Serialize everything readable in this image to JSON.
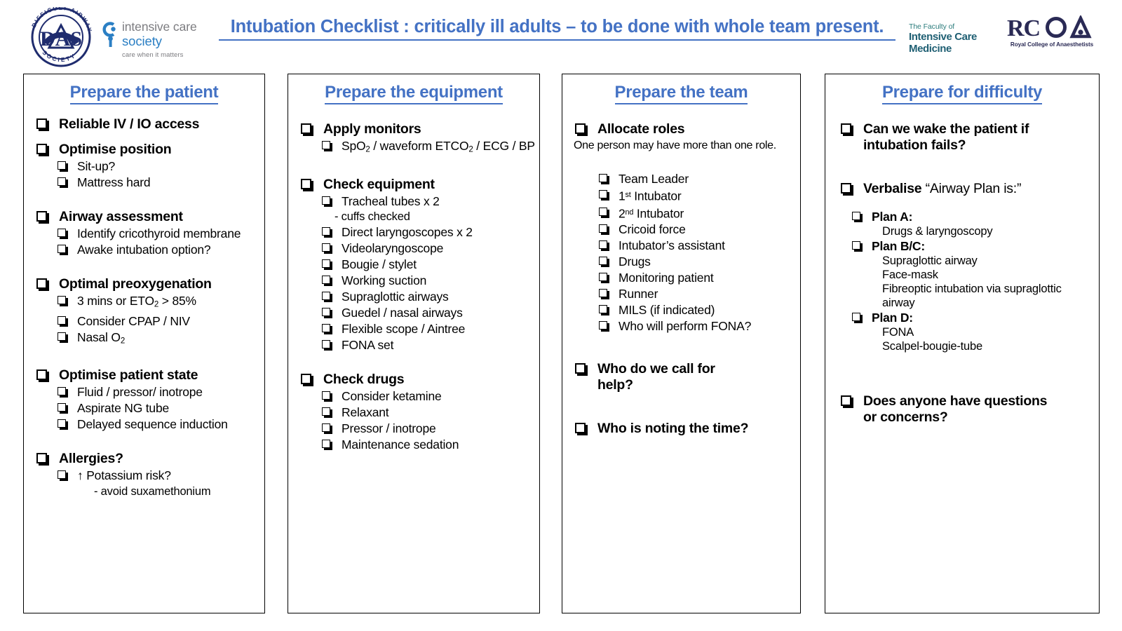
{
  "header": {
    "title": "Intubation Checklist : critically ill adults – to be done with whole team present.",
    "das_logo": {
      "name": "das-logo",
      "initials": "DAS",
      "ring_top": "DIFFICULT AIRWAY",
      "ring_bottom": "SOCIETY"
    },
    "ics_logo": {
      "line1": "intensive care",
      "line2": "society",
      "tagline": "care when it matters"
    },
    "ficm_logo": {
      "line1": "The Faculty of",
      "line2": "Intensive Care Medicine"
    },
    "rcoa_logo": {
      "mark": "RCOA",
      "subtitle": "Royal College of Anaesthetists"
    },
    "colors": {
      "title_blue": "#4472C4",
      "das_navy": "#1F2C6E",
      "ics_blue": "#2B7FC4",
      "ficm_teal": "#1F5F73",
      "rcoa_navy": "#2A2A55"
    }
  },
  "columns": [
    {
      "title": "Prepare the patient",
      "items": [
        {
          "level": 1,
          "text": "Reliable IV / IO access"
        },
        {
          "level": 1,
          "text": "Optimise position"
        },
        {
          "level": 2,
          "text": "Sit-up?"
        },
        {
          "level": 2,
          "text": "Mattress hard"
        },
        {
          "level": 1,
          "text": "Airway assessment"
        },
        {
          "level": 2,
          "text": "Identify cricothyroid membrane"
        },
        {
          "level": 2,
          "text": "Awake intubation option?"
        },
        {
          "level": 1,
          "text": "Optimal preoxygenation"
        },
        {
          "level": 2,
          "text": "3 mins or ETO2 > 85%"
        },
        {
          "level": 2,
          "text": "Consider CPAP / NIV"
        },
        {
          "level": 2,
          "text": "Nasal O2"
        },
        {
          "level": 1,
          "text": "Optimise patient state"
        },
        {
          "level": 2,
          "text": "Fluid / pressor/ inotrope"
        },
        {
          "level": 2,
          "text": "Aspirate NG tube"
        },
        {
          "level": 2,
          "text": "Delayed sequence induction"
        },
        {
          "level": 1,
          "text": "Allergies?"
        },
        {
          "level": 2,
          "text": "↑ Potassium risk?"
        },
        {
          "level": 0,
          "text": "- avoid suxamethonium"
        }
      ]
    },
    {
      "title": "Prepare the equipment",
      "items": [
        {
          "level": 1,
          "text": "Apply monitors"
        },
        {
          "level": 2,
          "text": "SpO2 / waveform ETCO2 / ECG / BP"
        },
        {
          "level": 1,
          "text": "Check equipment"
        },
        {
          "level": 2,
          "text": "Tracheal tubes x 2"
        },
        {
          "level": 0,
          "text": "- cuffs checked"
        },
        {
          "level": 2,
          "text": "Direct laryngoscopes x 2"
        },
        {
          "level": 2,
          "text": "Videolaryngoscope"
        },
        {
          "level": 2,
          "text": "Bougie / stylet"
        },
        {
          "level": 2,
          "text": "Working suction"
        },
        {
          "level": 2,
          "text": "Supraglottic airways"
        },
        {
          "level": 2,
          "text": "Guedel / nasal airways"
        },
        {
          "level": 2,
          "text": "Flexible scope / Aintree"
        },
        {
          "level": 2,
          "text": "FONA set"
        },
        {
          "level": 1,
          "text": "Check drugs"
        },
        {
          "level": 2,
          "text": "Consider ketamine"
        },
        {
          "level": 2,
          "text": "Relaxant"
        },
        {
          "level": 2,
          "text": "Pressor / inotrope"
        },
        {
          "level": 2,
          "text": "Maintenance sedation"
        }
      ]
    },
    {
      "title": "Prepare the team",
      "note": "One person may have more than one role.",
      "items": [
        {
          "level": 1,
          "text": "Allocate roles"
        },
        {
          "level": 2,
          "text": "Team Leader"
        },
        {
          "level": 2,
          "text": "1st Intubator"
        },
        {
          "level": 2,
          "text": "2nd Intubator"
        },
        {
          "level": 2,
          "text": "Cricoid force"
        },
        {
          "level": 2,
          "text": "Intubator’s assistant"
        },
        {
          "level": 2,
          "text": "Drugs"
        },
        {
          "level": 2,
          "text": "Monitoring patient"
        },
        {
          "level": 2,
          "text": "Runner"
        },
        {
          "level": 2,
          "text": "MILS (if indicated)"
        },
        {
          "level": 2,
          "text": "Who will perform FONA?"
        },
        {
          "level": 1,
          "text": "Who do we call for help?"
        },
        {
          "level": 1,
          "text": "Who is noting the time?"
        }
      ]
    },
    {
      "title": "Prepare for difficulty",
      "items": [
        {
          "level": 1,
          "text": "Can we wake the patient if intubation fails?"
        },
        {
          "level": 1,
          "text_bold": "Verbalise",
          "text_plain": " “Airway Plan is:”"
        },
        {
          "level": 2,
          "text": "Plan A:"
        },
        {
          "level": 0,
          "text": "Drugs & laryngoscopy"
        },
        {
          "level": 2,
          "text": "Plan B/C:"
        },
        {
          "level": 0,
          "text": "Supraglottic airway"
        },
        {
          "level": 0,
          "text": "Face-mask"
        },
        {
          "level": 0,
          "text": "Fibreoptic intubation via supraglottic airway"
        },
        {
          "level": 2,
          "text": "Plan D:"
        },
        {
          "level": 0,
          "text": "FONA"
        },
        {
          "level": 0,
          "text": "Scalpel-bougie-tube"
        },
        {
          "level": 1,
          "text": "Does anyone have questions or concerns?"
        }
      ]
    }
  ]
}
